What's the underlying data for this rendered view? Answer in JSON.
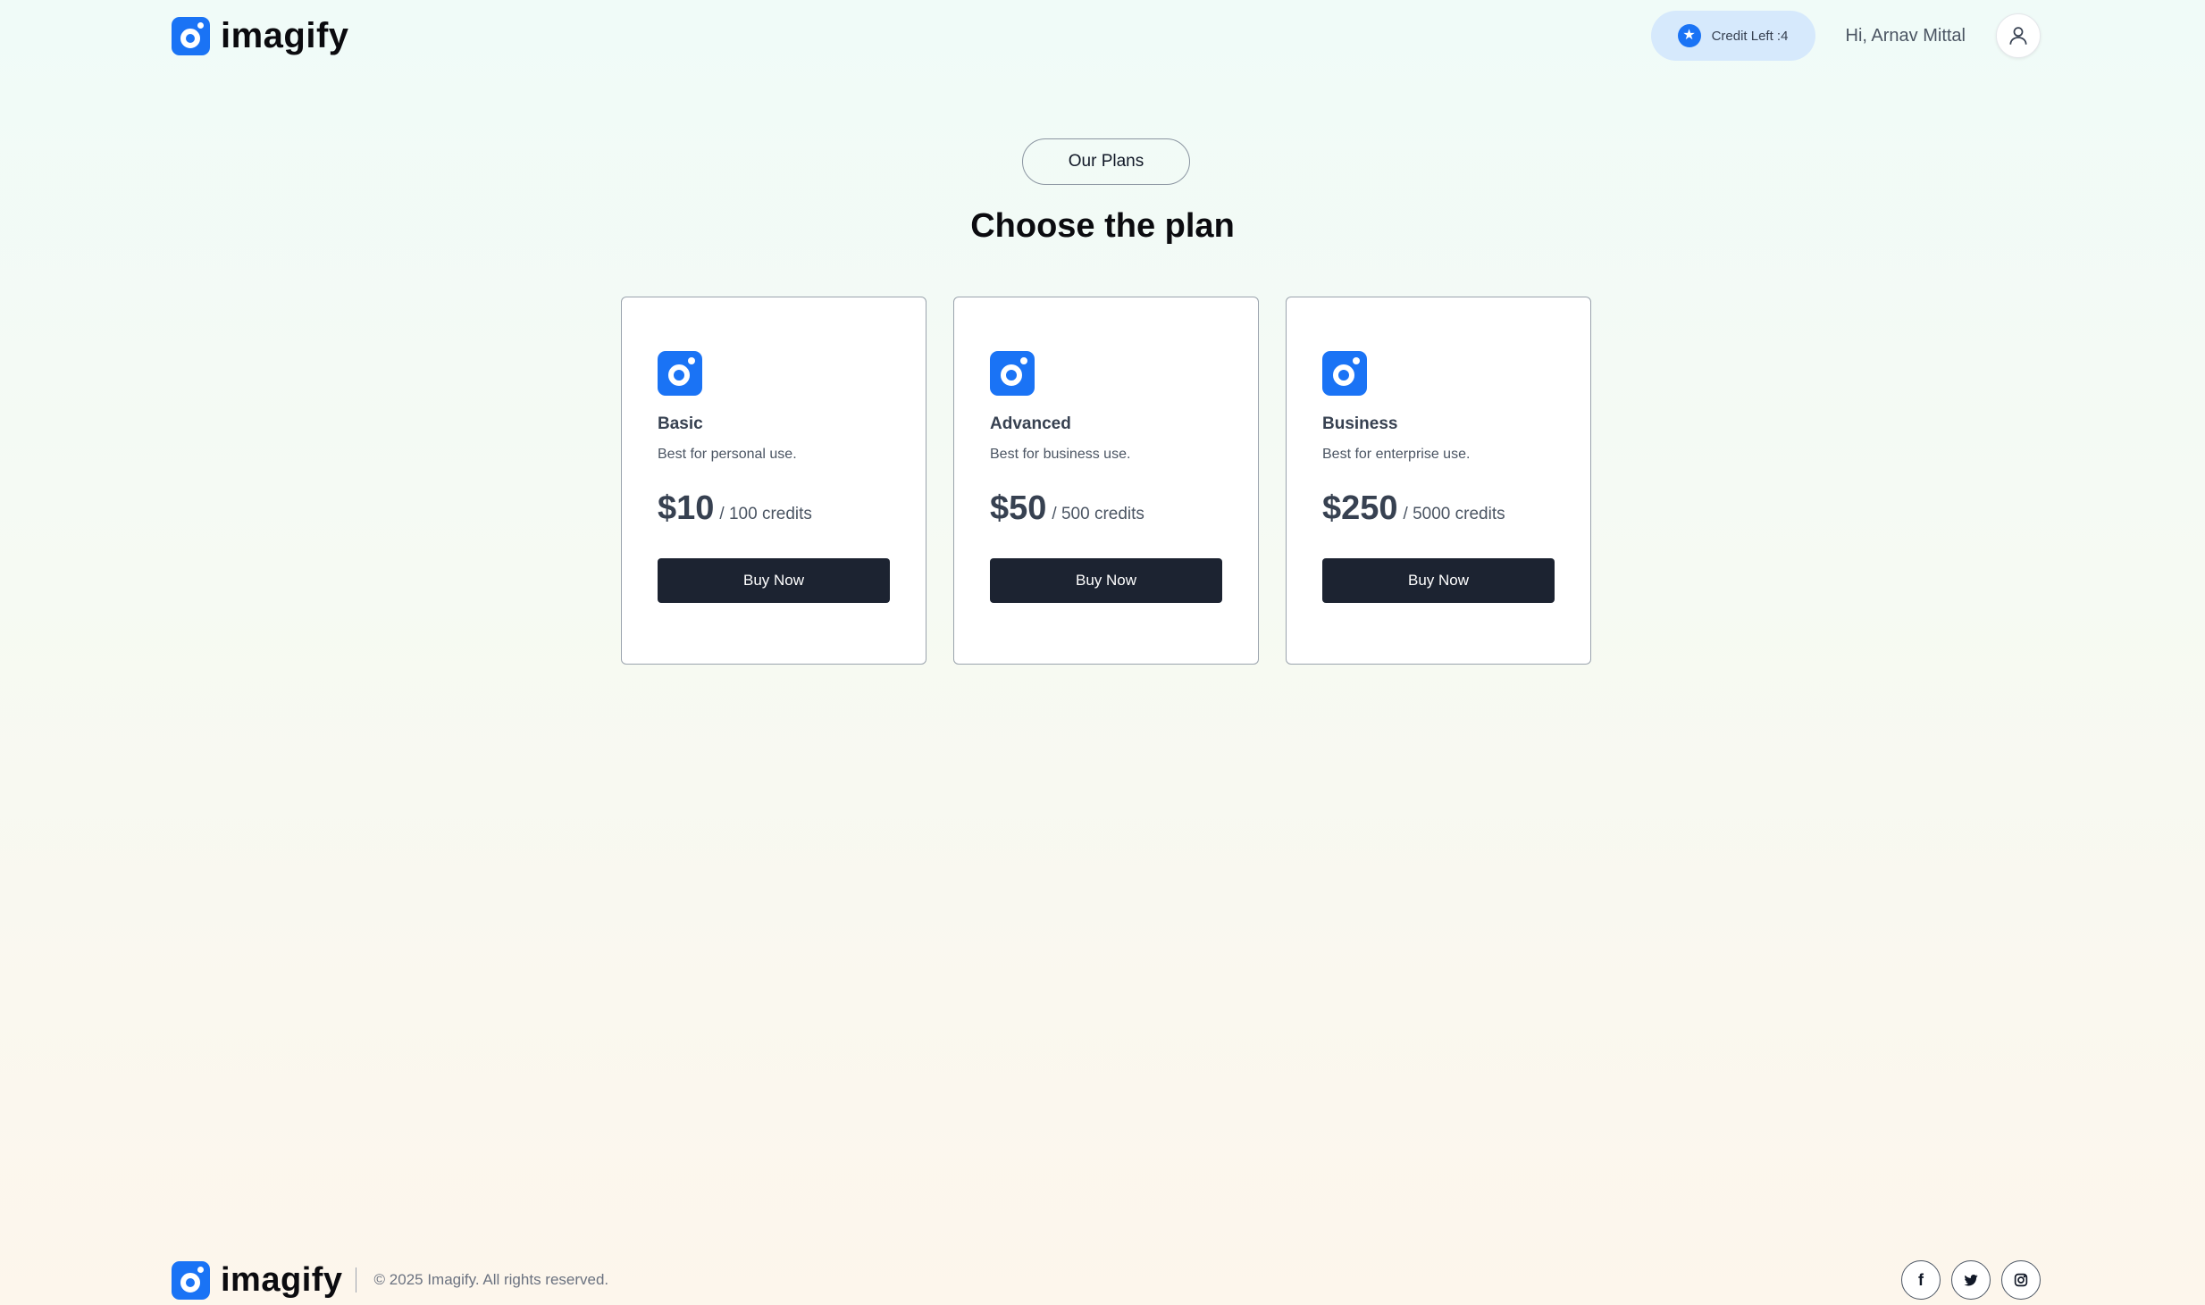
{
  "header": {
    "brand": "imagify",
    "credit_label": "Credit Left :4",
    "greeting": "Hi, Arnav Mittal"
  },
  "section": {
    "badge": "Our Plans",
    "title": "Choose the plan"
  },
  "plans": [
    {
      "name": "Basic",
      "description": "Best for personal use.",
      "price": "$10",
      "credits": "/ 100 credits",
      "button": "Buy Now"
    },
    {
      "name": "Advanced",
      "description": "Best for business use.",
      "price": "$50",
      "credits": "/ 500 credits",
      "button": "Buy Now"
    },
    {
      "name": "Business",
      "description": "Best for enterprise use.",
      "price": "$250",
      "credits": "/ 5000 credits",
      "button": "Buy Now"
    }
  ],
  "footer": {
    "brand": "imagify",
    "copyright": "© 2025 Imagify. All rights reserved.",
    "socials": [
      "facebook-icon",
      "twitter-icon",
      "instagram-icon"
    ]
  },
  "colors": {
    "accent": "#1a73f5",
    "button": "#1c2331",
    "credit_pill": "#d6e9fc"
  }
}
